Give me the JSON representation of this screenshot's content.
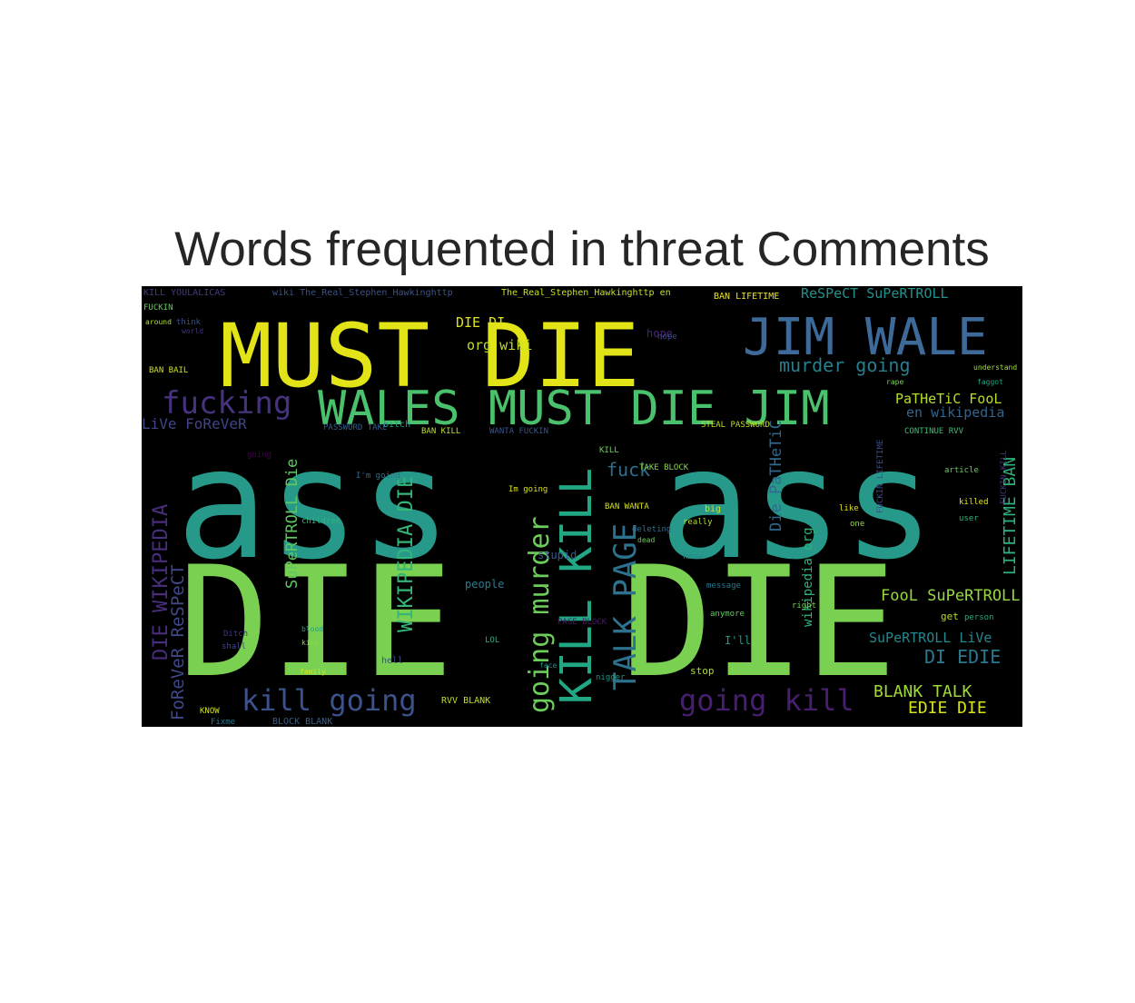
{
  "figure": {
    "title": "Words frequented in threat Comments"
  },
  "wordcloud": {
    "words": [
      {
        "text": "ass",
        "color": "#26998a"
      },
      {
        "text": "ass",
        "color": "#26998a"
      },
      {
        "text": "DIE",
        "color": "#7ad151"
      },
      {
        "text": "DIE",
        "color": "#7ad151"
      },
      {
        "text": "MUST DIE",
        "color": "#e2e418"
      },
      {
        "text": "JIM WALE",
        "color": "#3e6a9a"
      },
      {
        "text": "WALES MUST DIE JIM",
        "color": "#4ac16d"
      },
      {
        "text": "fucking",
        "color": "#46327e"
      },
      {
        "text": "KILL KILL",
        "color": "#22a785"
      },
      {
        "text": "TALK PAGE",
        "color": "#2c728e"
      },
      {
        "text": "going murder",
        "color": "#6ccd5a"
      },
      {
        "text": "kill going",
        "color": "#3b528b"
      },
      {
        "text": "going kill",
        "color": "#481f70"
      },
      {
        "text": "WIKIPEDIA DIE",
        "color": "#34b679"
      },
      {
        "text": "DIE WIKIPEDIA",
        "color": "#472d7b"
      },
      {
        "text": "FoReVeR ReSPeCT",
        "color": "#3f4889"
      },
      {
        "text": "SuPeRTROLL Die",
        "color": "#5ec962"
      },
      {
        "text": "Die PaTHeTiC",
        "color": "#31688e"
      },
      {
        "text": "LIFETIME BAN",
        "color": "#2db27d"
      },
      {
        "text": "murder going",
        "color": "#277f8e"
      },
      {
        "text": "PaTHeTiC FooL",
        "color": "#b5de2b"
      },
      {
        "text": "en wikipedia",
        "color": "#33638d"
      },
      {
        "text": "FooL SuPeRTROLL",
        "color": "#95d840"
      },
      {
        "text": "SuPeRTROLL LiVe",
        "color": "#24868e"
      },
      {
        "text": "DI EDIE",
        "color": "#2a788e"
      },
      {
        "text": "BLANK TALK",
        "color": "#a0da39"
      },
      {
        "text": "EDIE DIE",
        "color": "#d8e219"
      },
      {
        "text": "LiVe FoReVeR",
        "color": "#414487"
      },
      {
        "text": "DIE DI",
        "color": "#dde318"
      },
      {
        "text": "org wiki",
        "color": "#c0df25"
      },
      {
        "text": "fuck",
        "color": "#2e6f8e"
      },
      {
        "text": "ReSPeCT SuPeRTROLL",
        "color": "#21918c"
      },
      {
        "text": "KILL YOULALICAS",
        "color": "#443983"
      },
      {
        "text": "wiki The_Real_Stephen_Hawkinghttp",
        "color": "#3b528b"
      },
      {
        "text": "The_Real_Stephen_Hawkinghttp en",
        "color": "#c8e020"
      },
      {
        "text": "BAN LIFETIME",
        "color": "#eae51a"
      },
      {
        "text": "stupid",
        "color": "#38588c"
      },
      {
        "text": "people",
        "color": "#287c8e"
      },
      {
        "text": "wikipedia org",
        "color": "#2fb47c"
      },
      {
        "text": "BAN BAIL",
        "color": "#d0e11c"
      },
      {
        "text": "hope",
        "color": "#482677"
      },
      {
        "text": "RVV BLANK",
        "color": "#c2df23"
      },
      {
        "text": "I'll",
        "color": "#1f9a8a"
      },
      {
        "text": "stop",
        "color": "#addc30"
      },
      {
        "text": "KILL",
        "color": "#6ece58"
      },
      {
        "text": "BAN WANTA",
        "color": "#d5e21a"
      },
      {
        "text": "PASSWORD TAKE",
        "color": "#355f8d"
      },
      {
        "text": "BAN KILL",
        "color": "#b8de29"
      },
      {
        "text": "STEAL PASSWORD",
        "color": "#bddf26"
      },
      {
        "text": "WANTA FUCKIN",
        "color": "#3a548c"
      },
      {
        "text": "CONTINUE RVV",
        "color": "#40bd72"
      },
      {
        "text": "FUCKIN LIFETIME",
        "color": "#3d4e8a"
      },
      {
        "text": "FUCKIN KILL",
        "color": "#46337f"
      },
      {
        "text": "FUCKIN",
        "color": "#65cb5e"
      },
      {
        "text": "I'm going",
        "color": "#2e6e8e"
      },
      {
        "text": "Im going",
        "color": "#dae319"
      },
      {
        "text": "going",
        "color": "#440154"
      },
      {
        "text": "TAKE BLOCK",
        "color": "#85d54a"
      },
      {
        "text": "PAGE BLOCK",
        "color": "#48186a"
      },
      {
        "text": "Ditch",
        "color": "#463480"
      },
      {
        "text": "shall",
        "color": "#3f4788"
      },
      {
        "text": "KNOW",
        "color": "#d2e21b"
      },
      {
        "text": "Fixme",
        "color": "#2a768e"
      },
      {
        "text": "BLOCK BLANK",
        "color": "#34618d"
      },
      {
        "text": "blood",
        "color": "#1e9c89"
      },
      {
        "text": "kick",
        "color": "#90d743"
      },
      {
        "text": "rape",
        "color": "#7cd250"
      },
      {
        "text": "think",
        "color": "#3c4f8a"
      },
      {
        "text": "world",
        "color": "#472f7d"
      },
      {
        "text": "around",
        "color": "#b2dd2d"
      },
      {
        "text": "faggot",
        "color": "#20a386"
      },
      {
        "text": "understand",
        "color": "#a5db36"
      },
      {
        "text": "article",
        "color": "#67cc5c"
      },
      {
        "text": "face",
        "color": "#20928c"
      },
      {
        "text": "children",
        "color": "#31b57b"
      },
      {
        "text": "deleting",
        "color": "#2c718e"
      },
      {
        "text": "dead",
        "color": "#6ccd5a"
      },
      {
        "text": "big",
        "color": "#cae11f"
      },
      {
        "text": "really",
        "color": "#b0dd2f"
      },
      {
        "text": "know",
        "color": "#24878e"
      },
      {
        "text": "one",
        "color": "#95d840"
      },
      {
        "text": "like",
        "color": "#dfe318"
      },
      {
        "text": "get",
        "color": "#b8de29"
      },
      {
        "text": "bitch",
        "color": "#1fa287"
      },
      {
        "text": "anymore",
        "color": "#5ec962"
      },
      {
        "text": "killed",
        "color": "#e5e419"
      },
      {
        "text": "user",
        "color": "#34b679"
      },
      {
        "text": "message",
        "color": "#2a788e"
      },
      {
        "text": "hell",
        "color": "#3b528b"
      },
      {
        "text": "nigger",
        "color": "#1f968b"
      },
      {
        "text": "family",
        "color": "#d0e11c"
      },
      {
        "text": "person",
        "color": "#25ab82"
      },
      {
        "text": "right",
        "color": "#73d056"
      },
      {
        "text": "nope",
        "color": "#3e4989"
      },
      {
        "text": "LOL",
        "color": "#29af7f"
      }
    ]
  }
}
